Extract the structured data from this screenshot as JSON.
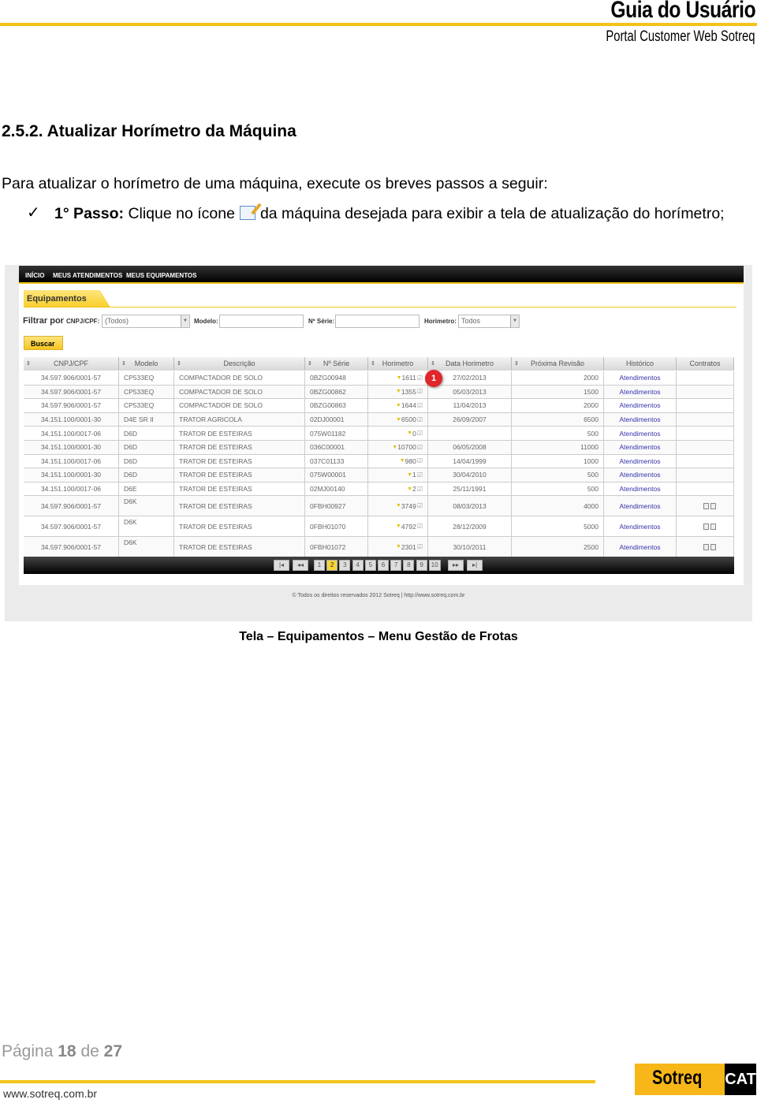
{
  "header": {
    "title": "Guia do Usuário",
    "subtitle": "Portal Customer Web Sotreq"
  },
  "section_title": "2.5.2.  Atualizar Horímetro da Máquina",
  "intro": "Para atualizar o horímetro de uma máquina, execute os breves passos a seguir:",
  "step": {
    "label": "1° Passo:",
    "text_before": "Clique no ícone",
    "text_after": "da máquina desejada para exibir a tela de atualização do horímetro;",
    "icon": "edit-icon"
  },
  "screenshot": {
    "nav": [
      "INÍCIO",
      "MEUS ATENDIMENTOS",
      "MEUS EQUIPAMENTOS"
    ],
    "tab": "Equipamentos",
    "filter": {
      "label": "Filtrar por",
      "cnpj_label": "CNPJ/CPF:",
      "cnpj_value": "(Todos)",
      "modelo_label": "Modelo:",
      "modelo_value": "",
      "serie_label": "Nº Série:",
      "serie_value": "",
      "horimetro_label": "Horimetro:",
      "horimetro_value": "Todos"
    },
    "search_button": "Buscar",
    "columns": [
      "CNPJ/CPF",
      "Modelo",
      "Descrição",
      "Nº Série",
      "Horimetro",
      "Data Horimetro",
      "Próxima Revisão",
      "Histórico",
      "Contratos"
    ],
    "rows": [
      [
        "34.597.906/0001-57",
        "CP533EQ",
        "COMPACTADOR DE SOLO",
        "0BZG00948",
        "1611",
        "27/02/2013",
        "2000",
        "Atendimentos",
        ""
      ],
      [
        "34.597.906/0001-57",
        "CP533EQ",
        "COMPACTADOR DE SOLO",
        "0BZG00862",
        "1355",
        "05/03/2013",
        "1500",
        "Atendimentos",
        ""
      ],
      [
        "34.597.906/0001-57",
        "CP533EQ",
        "COMPACTADOR DE SOLO",
        "0BZG00863",
        "1644",
        "11/04/2013",
        "2000",
        "Atendimentos",
        ""
      ],
      [
        "34.151.100/0001-30",
        "D4E SR II",
        "TRATOR AGRICOLA",
        "02DJ00001",
        "6500",
        "26/09/2007",
        "6500",
        "Atendimentos",
        ""
      ],
      [
        "34.151.100/0017-06",
        "D6D",
        "TRATOR DE ESTEIRAS",
        "075W01182",
        "0",
        "",
        "500",
        "Atendimentos",
        ""
      ],
      [
        "34.151.100/0001-30",
        "D6D",
        "TRATOR DE ESTEIRAS",
        "036C00001",
        "10700",
        "06/05/2008",
        "11000",
        "Atendimentos",
        ""
      ],
      [
        "34.151.100/0017-06",
        "D6D",
        "TRATOR DE ESTEIRAS",
        "037C01133",
        "980",
        "14/04/1999",
        "1000",
        "Atendimentos",
        ""
      ],
      [
        "34.151.100/0001-30",
        "D6D",
        "TRATOR DE ESTEIRAS",
        "075W00001",
        "1",
        "30/04/2010",
        "500",
        "Atendimentos",
        ""
      ],
      [
        "34.151.100/0017-06",
        "D6E",
        "TRATOR DE ESTEIRAS",
        "02MJ00140",
        "2",
        "25/11/1991",
        "500",
        "Atendimentos",
        ""
      ],
      [
        "34.597.906/0001-57",
        "D6K",
        "TRATOR DE ESTEIRAS",
        "0FBH00927",
        "3749",
        "08/03/2013",
        "4000",
        "Atendimentos",
        "docs"
      ],
      [
        "34.597.906/0001-57",
        "D6K",
        "TRATOR DE ESTEIRAS",
        "0FBH01070",
        "4792",
        "28/12/2009",
        "5000",
        "Atendimentos",
        "docs"
      ],
      [
        "34.597.906/0001-57",
        "D6K",
        "TRATOR DE ESTEIRAS",
        "0FBH01072",
        "2301",
        "30/10/2011",
        "2500",
        "Atendimentos",
        "docs"
      ]
    ],
    "pager": {
      "first": "|◂",
      "prev": "◂◂",
      "pages": [
        "1",
        "2",
        "3",
        "4",
        "5",
        "6",
        "7",
        "8",
        "9",
        "10"
      ],
      "current": "2",
      "next": "▸▸",
      "last": "▸|"
    },
    "copyright": "© Todos os direitos reservados 2012 Sotreq | http://www.sotreq.com.br",
    "badge": "1"
  },
  "caption": "Tela – Equipamentos – Menu Gestão de Frotas",
  "footer": {
    "page_label": "Página",
    "page": "18",
    "of": "de",
    "total": "27",
    "url": "www.sotreq.com.br",
    "logo": "Sotreq",
    "cat": "CAT"
  },
  "colors": {
    "accent": "#f2c318",
    "badge": "#e0262a",
    "link": "#3333aa"
  }
}
